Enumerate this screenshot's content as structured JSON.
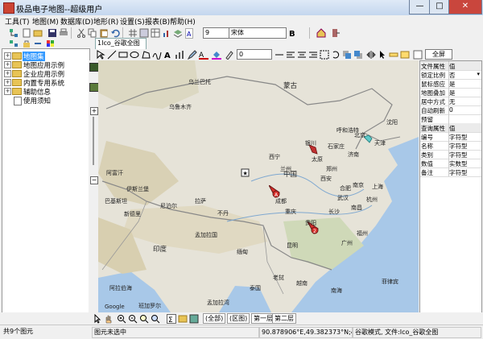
{
  "window": {
    "title": "极品电子地图--超级用户",
    "minimize": "—",
    "maximize": "□",
    "close": "✕"
  },
  "menubar": [
    "工具(T)",
    "地图(M)",
    "数据库(D)",
    "地形(R)",
    "设置(S)",
    "报表(B)",
    "帮助(H)"
  ],
  "toolbar": {
    "font_size_value": "9",
    "font_name_value": "宋体",
    "line_width_value": "0",
    "full_view_label": "全屏"
  },
  "map_tab": {
    "label": "1Ico_谷歌全图"
  },
  "tree": {
    "items": [
      {
        "label": "地图集",
        "selected": true
      },
      {
        "label": "地图应用示例",
        "selected": false
      },
      {
        "label": "企业应用示例",
        "selected": false
      },
      {
        "label": "内置专用系统",
        "selected": false
      },
      {
        "label": "辅助信息",
        "selected": false
      },
      {
        "label": "使用须知",
        "selected": false
      }
    ]
  },
  "map": {
    "labels": [
      {
        "text": "乌兰巴托",
        "big": false
      },
      {
        "text": "乌鲁木齐",
        "big": false
      },
      {
        "text": "蒙古",
        "big": true
      },
      {
        "text": "中国",
        "big": true
      },
      {
        "text": "北京",
        "big": false
      },
      {
        "text": "天津",
        "big": false
      },
      {
        "text": "沈阳",
        "big": false
      },
      {
        "text": "呼和浩特",
        "big": false
      },
      {
        "text": "银川",
        "big": false
      },
      {
        "text": "石家庄",
        "big": false
      },
      {
        "text": "太原",
        "big": false
      },
      {
        "text": "济南",
        "big": false
      },
      {
        "text": "西宁",
        "big": false
      },
      {
        "text": "兰州",
        "big": false
      },
      {
        "text": "郑州",
        "big": false
      },
      {
        "text": "西安",
        "big": false
      },
      {
        "text": "南京",
        "big": false
      },
      {
        "text": "合肥",
        "big": false
      },
      {
        "text": "上海",
        "big": false
      },
      {
        "text": "武汉",
        "big": false
      },
      {
        "text": "杭州",
        "big": false
      },
      {
        "text": "成都",
        "big": false
      },
      {
        "text": "重庆",
        "big": false
      },
      {
        "text": "长沙",
        "big": false
      },
      {
        "text": "南昌",
        "big": false
      },
      {
        "text": "贵阳",
        "big": false
      },
      {
        "text": "福州",
        "big": false
      },
      {
        "text": "昆明",
        "big": false
      },
      {
        "text": "广州",
        "big": false
      },
      {
        "text": "拉萨",
        "big": false
      },
      {
        "text": "尼泊尔",
        "big": false
      },
      {
        "text": "不丹",
        "big": false
      },
      {
        "text": "印度",
        "big": true
      },
      {
        "text": "新德里",
        "big": false
      },
      {
        "text": "缅甸",
        "big": false
      },
      {
        "text": "孟加拉国",
        "big": false
      },
      {
        "text": "老挝",
        "big": false
      },
      {
        "text": "泰国",
        "big": false
      },
      {
        "text": "越南",
        "big": false
      },
      {
        "text": "南海",
        "big": false
      },
      {
        "text": "菲律宾",
        "big": false
      },
      {
        "text": "阿富汗",
        "big": false
      },
      {
        "text": "巴基斯坦",
        "big": false
      },
      {
        "text": "伊斯兰堡",
        "big": false
      },
      {
        "text": "阿拉伯海",
        "big": false
      },
      {
        "text": "孟加拉湾",
        "big": false
      },
      {
        "text": "班加罗尔",
        "big": false
      },
      {
        "text": "Google",
        "big": false
      }
    ],
    "markers": [
      "A",
      "2"
    ]
  },
  "props": {
    "file_header_key": "文件属性",
    "file_header_val": "值",
    "file_rows": [
      {
        "k": "锁定比例",
        "v": "否"
      },
      {
        "k": "鼠标感应",
        "v": "是"
      },
      {
        "k": "地图叠加",
        "v": "是"
      },
      {
        "k": "居中方式",
        "v": "无"
      },
      {
        "k": "自动刷新",
        "v": "0"
      },
      {
        "k": "预留",
        "v": ""
      }
    ],
    "query_header_key": "查询属性",
    "query_header_val": "值",
    "query_rows": [
      {
        "k": "编号",
        "v": "字符型"
      },
      {
        "k": "名称",
        "v": "字符型"
      },
      {
        "k": "类别",
        "v": "字符型"
      },
      {
        "k": "数值",
        "v": "实数型"
      },
      {
        "k": "备注",
        "v": "字符型"
      }
    ]
  },
  "layer_tabs": [
    "(全部)",
    "(区图)",
    "第一层",
    "第二层"
  ],
  "status": {
    "count": "共9个图元",
    "selection": "图元未选中",
    "coords": "90.878906°E,49.382373°N;4级",
    "mode": "谷歌模式, 文件:Ico_谷歌全图"
  },
  "colors": {
    "tree_selected": "#3399ff",
    "marker_red": "#d9302a",
    "sea": "#a8c8e8"
  }
}
